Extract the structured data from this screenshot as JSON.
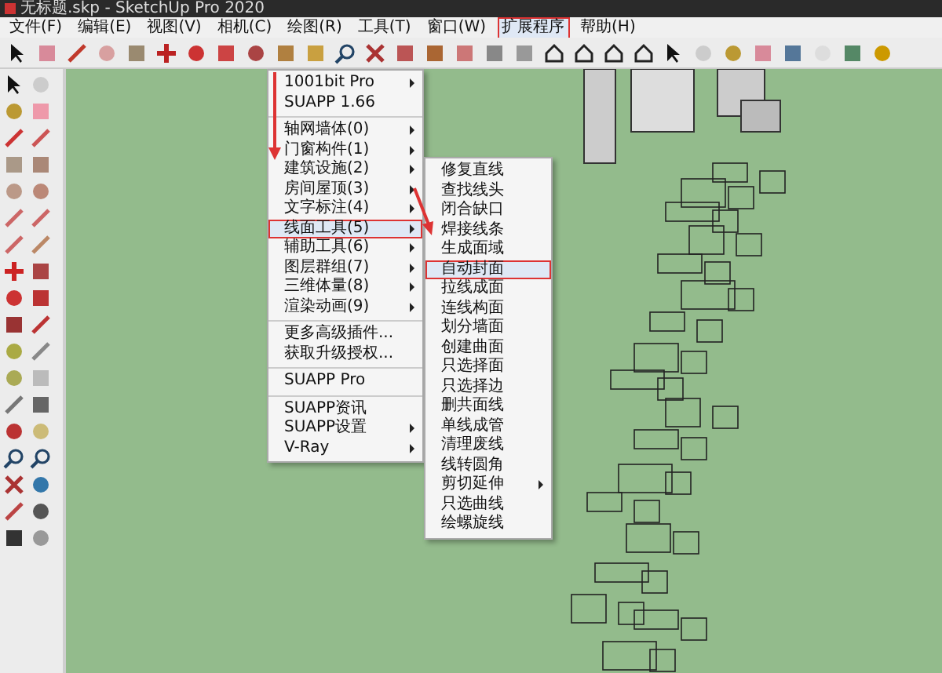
{
  "window": {
    "title": "无标题.skp - SketchUp Pro 2020"
  },
  "menu_bar": [
    {
      "label": "文件(F)",
      "selected": false
    },
    {
      "label": "编辑(E)",
      "selected": false
    },
    {
      "label": "视图(V)",
      "selected": false
    },
    {
      "label": "相机(C)",
      "selected": false
    },
    {
      "label": "绘图(R)",
      "selected": false
    },
    {
      "label": "工具(T)",
      "selected": false
    },
    {
      "label": "窗口(W)",
      "selected": false
    },
    {
      "label": "扩展程序",
      "selected": true
    },
    {
      "label": "帮助(H)",
      "selected": false
    }
  ],
  "extension_menu": {
    "groups": [
      {
        "items": [
          {
            "label": "1001bit Pro",
            "has_submenu": true,
            "selected": false
          },
          {
            "label": "SUAPP 1.66",
            "has_submenu": false,
            "selected": false
          }
        ]
      },
      {
        "items": [
          {
            "label": "轴网墙体(0)",
            "has_submenu": true,
            "selected": false
          },
          {
            "label": "门窗构件(1)",
            "has_submenu": true,
            "selected": false
          },
          {
            "label": "建筑设施(2)",
            "has_submenu": true,
            "selected": false
          },
          {
            "label": "房间屋顶(3)",
            "has_submenu": true,
            "selected": false
          },
          {
            "label": "文字标注(4)",
            "has_submenu": true,
            "selected": false
          },
          {
            "label": "线面工具(5)",
            "has_submenu": true,
            "selected": true
          },
          {
            "label": "辅助工具(6)",
            "has_submenu": true,
            "selected": false
          },
          {
            "label": "图层群组(7)",
            "has_submenu": true,
            "selected": false
          },
          {
            "label": "三维体量(8)",
            "has_submenu": true,
            "selected": false
          },
          {
            "label": "渲染动画(9)",
            "has_submenu": true,
            "selected": false
          }
        ]
      },
      {
        "items": [
          {
            "label": "更多高级插件...",
            "has_submenu": false,
            "selected": false
          },
          {
            "label": "获取升级授权...",
            "has_submenu": false,
            "selected": false
          }
        ]
      },
      {
        "items": [
          {
            "label": "SUAPP Pro",
            "has_submenu": false,
            "selected": false
          }
        ]
      },
      {
        "items": [
          {
            "label": "SUAPP资讯",
            "has_submenu": false,
            "selected": false
          },
          {
            "label": "SUAPP设置",
            "has_submenu": true,
            "selected": false
          },
          {
            "label": "V-Ray",
            "has_submenu": true,
            "selected": false
          }
        ]
      }
    ]
  },
  "line_tools_submenu": {
    "items": [
      {
        "label": "修复直线",
        "has_submenu": false,
        "selected": false
      },
      {
        "label": "查找线头",
        "has_submenu": false,
        "selected": false
      },
      {
        "label": "闭合缺口",
        "has_submenu": false,
        "selected": false
      },
      {
        "label": "焊接线条",
        "has_submenu": false,
        "selected": false
      },
      {
        "label": "生成面域",
        "has_submenu": false,
        "selected": false
      },
      {
        "label": "自动封面",
        "has_submenu": false,
        "selected": true
      },
      {
        "label": "拉线成面",
        "has_submenu": false,
        "selected": false
      },
      {
        "label": "连线构面",
        "has_submenu": false,
        "selected": false
      },
      {
        "label": "划分墙面",
        "has_submenu": false,
        "selected": false
      },
      {
        "label": "创建曲面",
        "has_submenu": false,
        "selected": false
      },
      {
        "label": "只选择面",
        "has_submenu": false,
        "selected": false
      },
      {
        "label": "只选择边",
        "has_submenu": false,
        "selected": false
      },
      {
        "label": "删共面线",
        "has_submenu": false,
        "selected": false
      },
      {
        "label": "单线成管",
        "has_submenu": false,
        "selected": false
      },
      {
        "label": "清理废线",
        "has_submenu": false,
        "selected": false
      },
      {
        "label": "线转圆角",
        "has_submenu": false,
        "selected": false
      },
      {
        "label": "剪切延伸",
        "has_submenu": true,
        "selected": false
      },
      {
        "label": "只选曲线",
        "has_submenu": false,
        "selected": false
      },
      {
        "label": "绘螺旋线",
        "has_submenu": false,
        "selected": false
      }
    ]
  }
}
